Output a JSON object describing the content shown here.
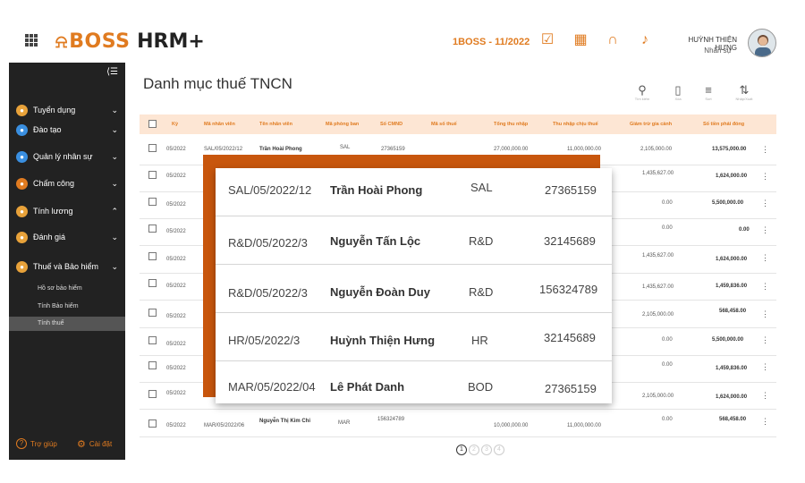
{
  "header": {
    "logo_text": "BOSS",
    "product": "HRM+",
    "period": "1BOSS - 11/2022",
    "user_name": "HUỲNH THIỆN HƯNG",
    "user_role": "Nhân sự"
  },
  "sidebar": {
    "items": [
      {
        "label": "Tuyển dụng",
        "color": "#e8a23a",
        "chevron": "⌄"
      },
      {
        "label": "Đào tạo",
        "color": "#3a8fe0",
        "chevron": "⌄"
      },
      {
        "label": "Quản lý nhân sự",
        "color": "#3a8fe0",
        "chevron": "⌄"
      },
      {
        "label": "Chấm công",
        "color": "#e07b20",
        "chevron": "⌄"
      },
      {
        "label": "Tính lương",
        "color": "#e8a23a",
        "chevron": "⌃"
      },
      {
        "label": "Đánh giá",
        "color": "#e8a23a",
        "chevron": "⌄"
      },
      {
        "label": "Thuế và Bảo hiểm",
        "color": "#e8a23a",
        "chevron": "⌄"
      }
    ],
    "sub_items": [
      "Hồ sơ bảo hiểm",
      "Tính Bảo hiểm",
      "Tính thuế"
    ],
    "help": "Trợ giúp",
    "settings": "Cài đặt"
  },
  "page": {
    "title": "Danh mục thuế TNCN",
    "tools": [
      "Tìm kiếm",
      "Xóa",
      "Sort",
      "Nhập/Xuất"
    ]
  },
  "table": {
    "headers": [
      "Kỳ",
      "Mã nhân viên",
      "Tên nhân viên",
      "Mã phòng ban",
      "Số CMND",
      "Mã số thuế",
      "Tổng thu nhập",
      "Thu nhập chịu thuế",
      "Giảm trừ gia cảnh",
      "Số tiền phải đóng"
    ],
    "rows": [
      {
        "ky": "05/2022",
        "ma": "SAL/05/2022/12",
        "ten": "Trần Hoài Phong",
        "pb": "SAL",
        "cmnd": "27365159",
        "tong": "27,000,000.00",
        "chiu": "11,000,000.00",
        "giam": "2,105,000.00",
        "dong": "13,575,000.00"
      },
      {
        "ky": "05/2022",
        "ma": "",
        "ten": "",
        "pb": "",
        "cmnd": "",
        "tong": "",
        "chiu": "",
        "giam": "1,435,627.00",
        "dong": "1,624,000.00"
      },
      {
        "ky": "05/2022",
        "ma": "",
        "ten": "",
        "pb": "",
        "cmnd": "",
        "tong": "",
        "chiu": "",
        "giam": "0.00",
        "dong": "5,500,000.00"
      },
      {
        "ky": "05/2022",
        "ma": "",
        "ten": "",
        "pb": "",
        "cmnd": "",
        "tong": "",
        "chiu": "",
        "giam": "0.00",
        "dong": "0.00"
      },
      {
        "ky": "05/2022",
        "ma": "",
        "ten": "",
        "pb": "",
        "cmnd": "",
        "tong": "",
        "chiu": "",
        "giam": "1,435,627.00",
        "dong": "1,624,000.00"
      },
      {
        "ky": "05/2022",
        "ma": "",
        "ten": "",
        "pb": "",
        "cmnd": "",
        "tong": "",
        "chiu": "",
        "giam": "1,435,627.00",
        "dong": "1,459,836.00"
      },
      {
        "ky": "05/2022",
        "ma": "",
        "ten": "",
        "pb": "",
        "cmnd": "",
        "tong": "",
        "chiu": "",
        "giam": "2,105,000.00",
        "dong": "568,458.00"
      },
      {
        "ky": "05/2022",
        "ma": "",
        "ten": "",
        "pb": "",
        "cmnd": "",
        "tong": "",
        "chiu": "",
        "giam": "0.00",
        "dong": "5,500,000.00"
      },
      {
        "ky": "05/2022",
        "ma": "",
        "ten": "",
        "pb": "",
        "cmnd": "",
        "tong": "",
        "chiu": "",
        "giam": "0.00",
        "dong": "1,459,836.00"
      },
      {
        "ky": "05/2022",
        "ma": "",
        "ten": "",
        "pb": "",
        "cmnd": "",
        "tong": "",
        "chiu": "",
        "giam": "2,105,000.00",
        "dong": "1,624,000.00"
      },
      {
        "ky": "05/2022",
        "ma": "MAR/05/2022/06",
        "ten": "Nguyễn Thị Kim Chi",
        "pb": "MAR",
        "cmnd": "156324789",
        "tong": "10,000,000.00",
        "chiu": "11,000,000.00",
        "giam": "0.00",
        "dong": "568,458.00"
      }
    ]
  },
  "popup": {
    "rows": [
      {
        "ma": "SAL/05/2022/12",
        "ten": "Trần Hoài Phong",
        "pb": "SAL",
        "cmnd": "27365159"
      },
      {
        "ma": "R&D/05/2022/3",
        "ten": "Nguyễn Tấn Lộc",
        "pb": "R&D",
        "cmnd": "32145689"
      },
      {
        "ma": "R&D/05/2022/3",
        "ten": "Nguyễn Đoàn Duy",
        "pb": "R&D",
        "cmnd": "156324789"
      },
      {
        "ma": "HR/05/2022/3",
        "ten": "Huỳnh Thiện Hưng",
        "pb": "HR",
        "cmnd": "32145689"
      },
      {
        "ma": "MAR/05/2022/04",
        "ten": "Lê Phát Danh",
        "pb": "BOD",
        "cmnd": "27365159"
      }
    ]
  },
  "pager": [
    "1",
    "2",
    "3",
    "4"
  ]
}
